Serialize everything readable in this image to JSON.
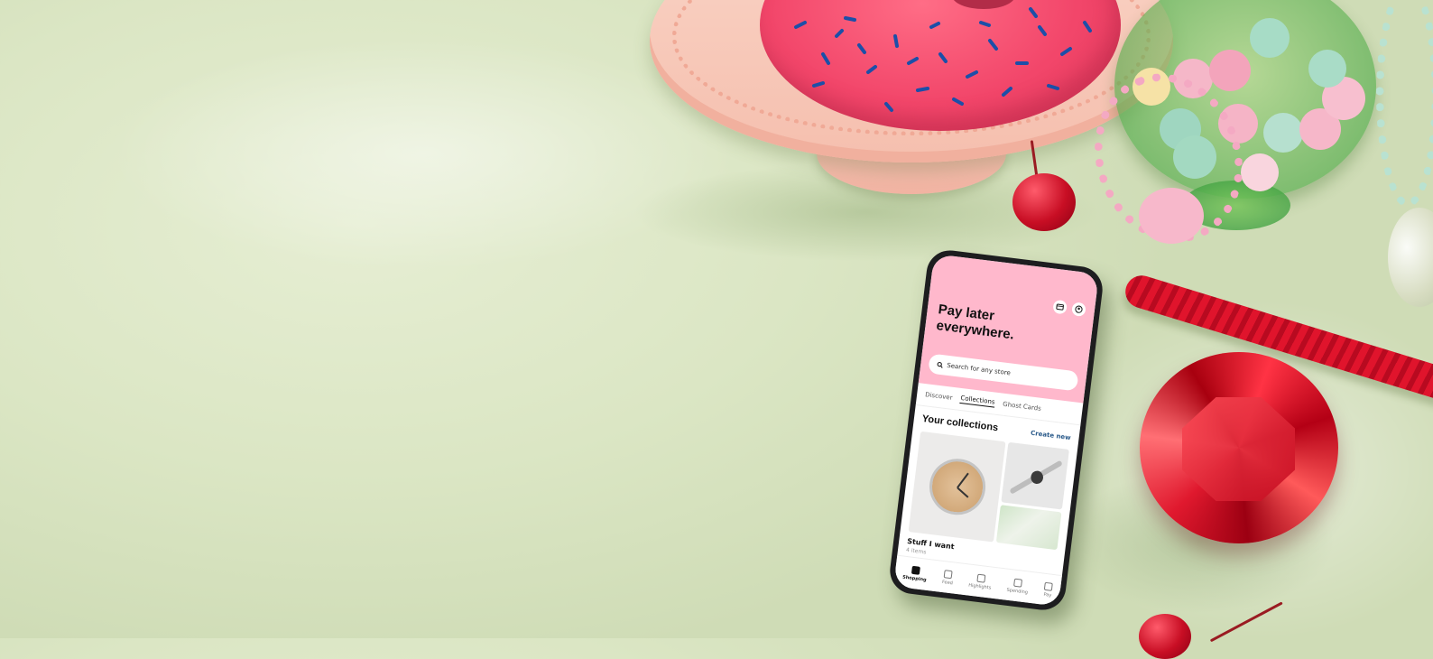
{
  "colors": {
    "background_silk": "#dbe6c4",
    "hero_pink": "#ffb8cc",
    "donut_glaze": "#f2466a",
    "licorice_red": "#e0142c",
    "gem_red": "#c3091e",
    "link_blue": "#2a5a8a"
  },
  "app": {
    "header": {
      "icons": [
        "card-icon",
        "profile-icon"
      ],
      "title": "Pay later everywhere."
    },
    "search": {
      "icon": "search-icon",
      "placeholder": "Search for any store"
    },
    "tabs": [
      {
        "label": "Discover",
        "active": false
      },
      {
        "label": "Collections",
        "active": true
      },
      {
        "label": "Ghost Cards",
        "active": false
      }
    ],
    "collections": {
      "section_title": "Your collections",
      "create_label": "Create new",
      "item": {
        "name": "Stuff I want",
        "count": "4 items"
      }
    },
    "nav": [
      {
        "label": "Shopping",
        "icon": "bag-icon",
        "active": true
      },
      {
        "label": "Feed",
        "icon": "feed-icon",
        "active": false
      },
      {
        "label": "Highlights",
        "icon": "glasses-icon",
        "active": false
      },
      {
        "label": "Spending",
        "icon": "wallet-icon",
        "active": false
      },
      {
        "label": "Pay",
        "icon": "pay-icon",
        "active": false
      }
    ]
  }
}
